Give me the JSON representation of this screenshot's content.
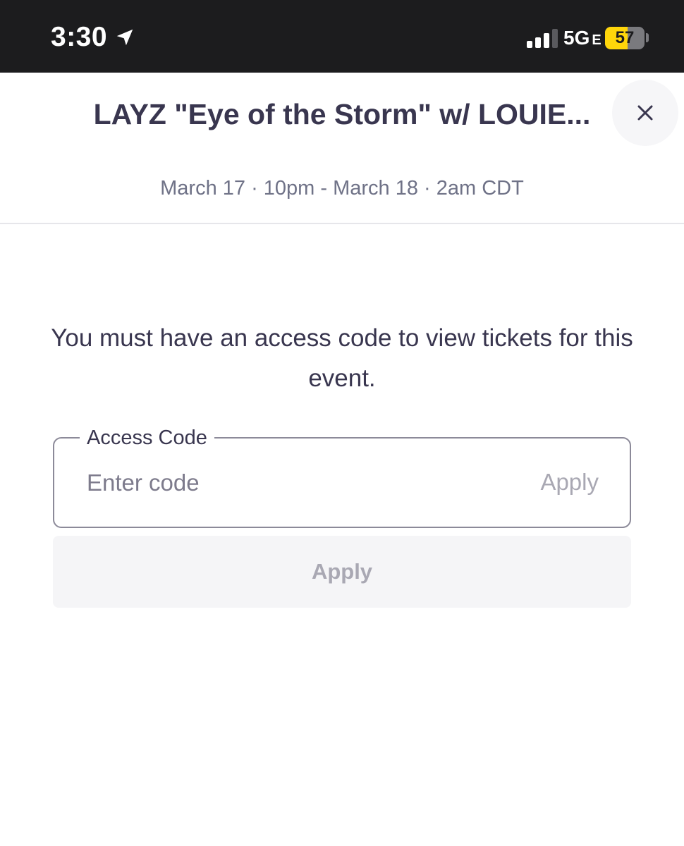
{
  "status_bar": {
    "time": "3:30",
    "network": "5G",
    "network_suffix": "E",
    "battery_level": "57",
    "battery_fraction": 0.57,
    "battery_color": "#ffd60a",
    "icons": [
      "location-arrow-icon",
      "cellular-signal-icon",
      "battery-icon"
    ]
  },
  "header": {
    "title": "LAYZ \"Eye of the Storm\" w/ LOUIE...",
    "close_icon": "close-icon",
    "dates": "March 17 · 10pm - March 18 · 2am CDT"
  },
  "access": {
    "message": "You must have an access code to view tickets for this event.",
    "field_label": "Access Code",
    "field_placeholder": "Enter code",
    "field_value": "",
    "inline_apply_label": "Apply",
    "apply_button_label": "Apply"
  },
  "colors": {
    "text_primary": "#39364f",
    "text_secondary": "#6f7287",
    "disabled": "#a9a8b3",
    "status_bar_bg": "#1c1c1e"
  }
}
